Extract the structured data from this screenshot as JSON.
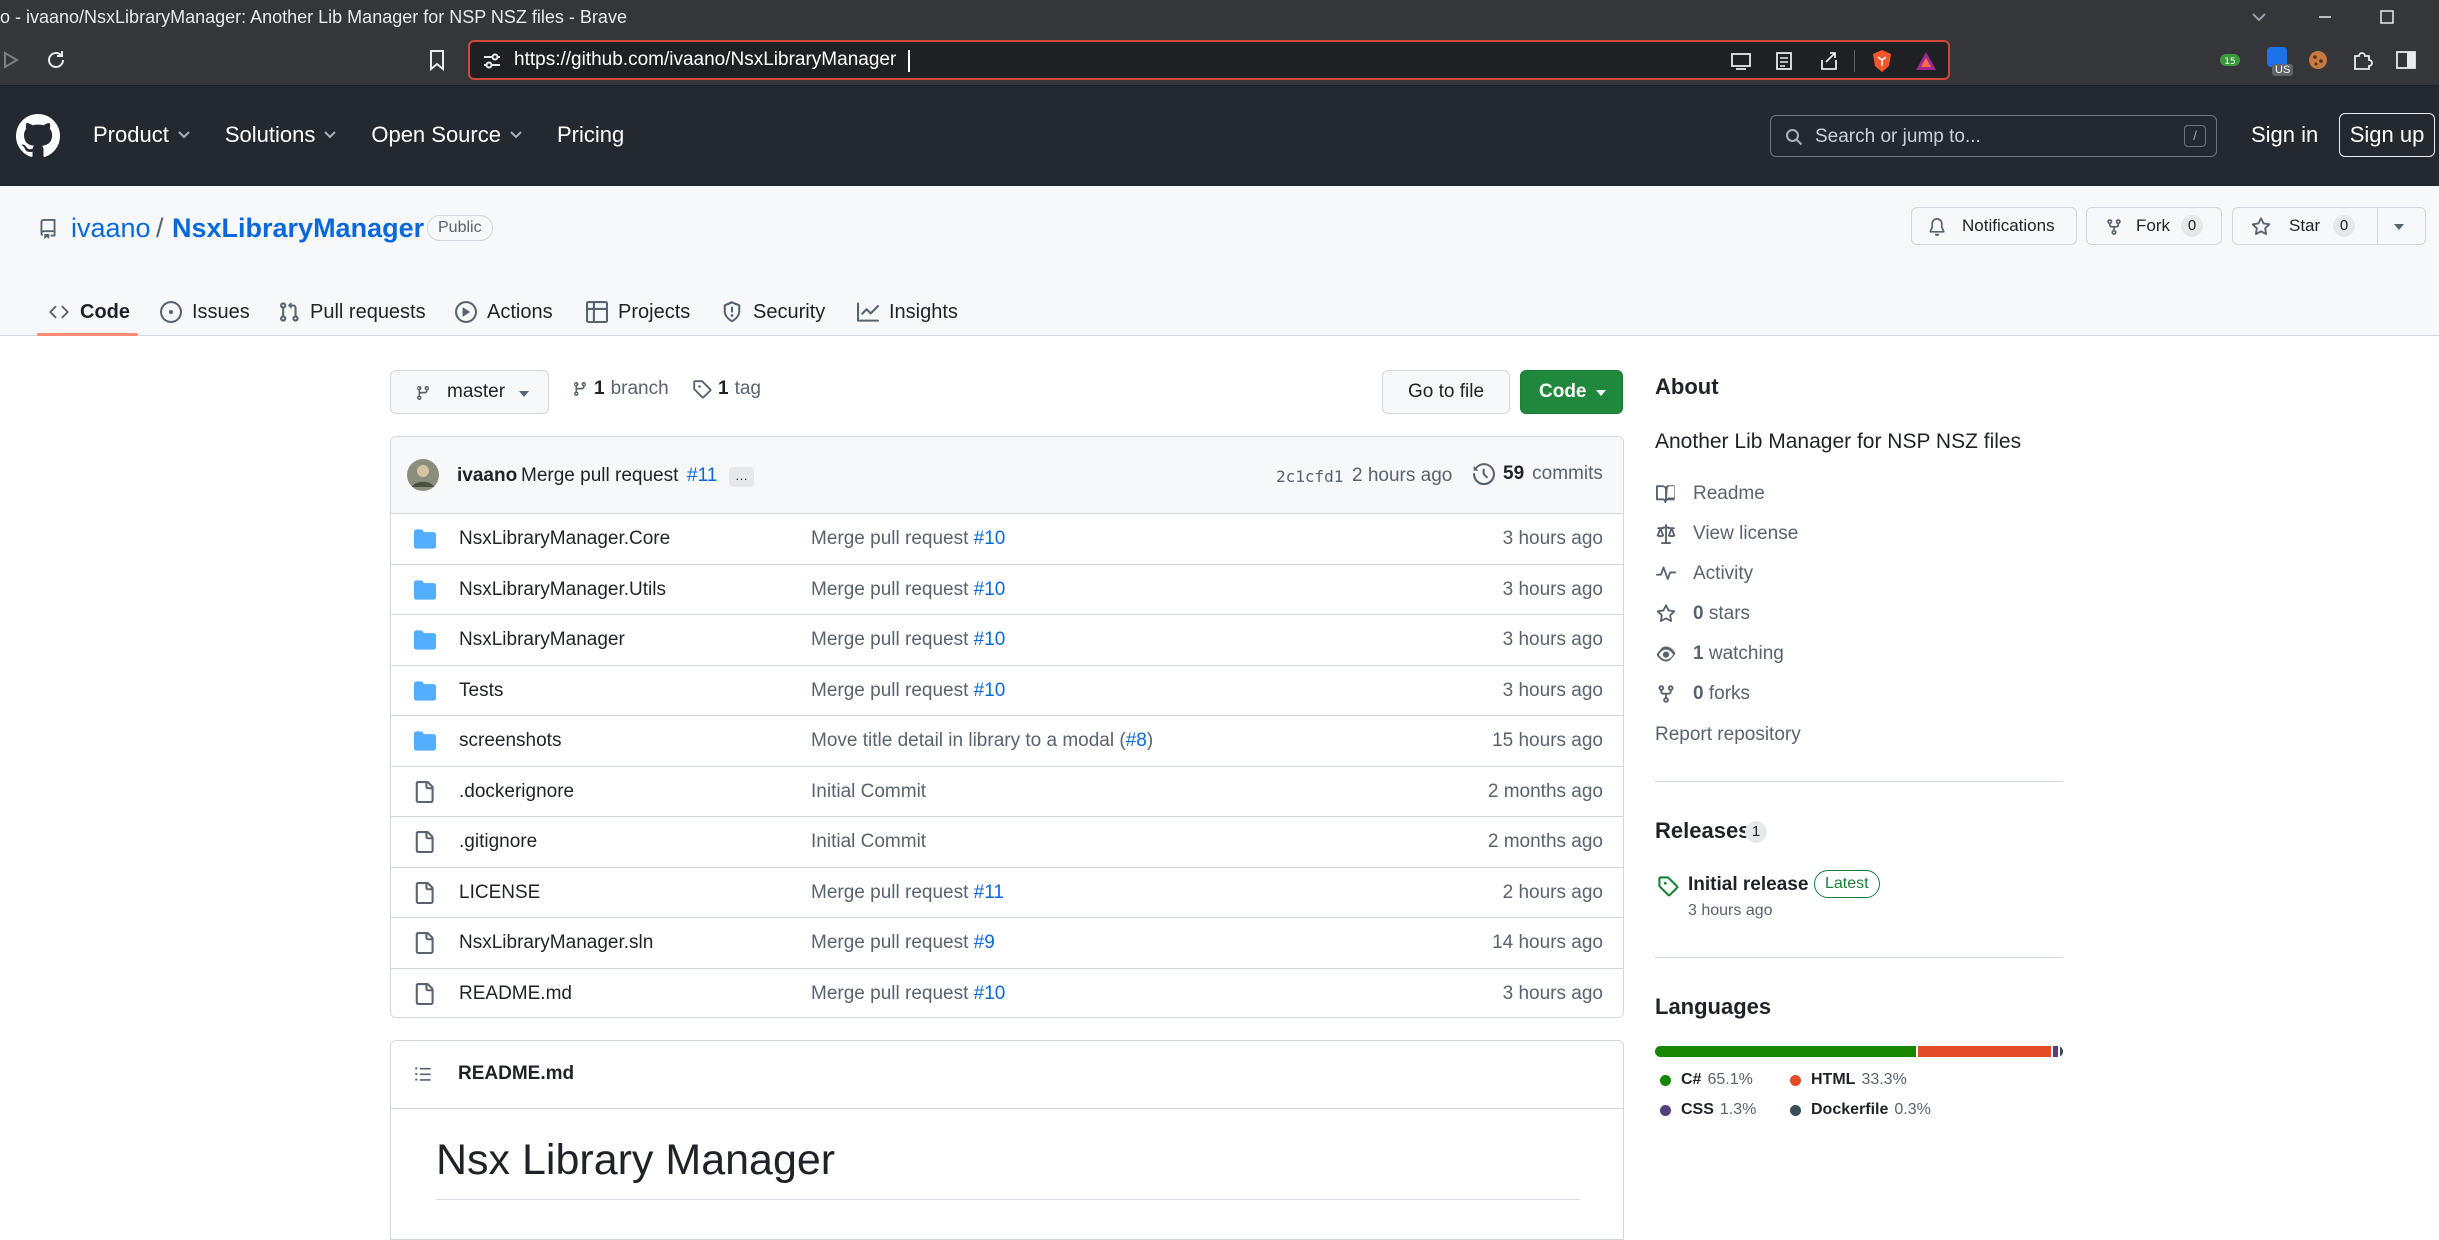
{
  "browser": {
    "window_title": "o - ivaano/NsxLibraryManager: Another Lib Manager for NSP NSZ files - Brave",
    "url": "https://github.com/ivaano/NsxLibraryManager",
    "ext_badge": "US"
  },
  "gh_header": {
    "nav": [
      "Product",
      "Solutions",
      "Open Source",
      "Pricing"
    ],
    "search_placeholder": "Search or jump to...",
    "search_kbd": "/",
    "sign_in": "Sign in",
    "sign_up": "Sign up"
  },
  "repo": {
    "owner": "ivaano",
    "separator": "/",
    "name": "NsxLibraryManager",
    "visibility": "Public",
    "notifications": "Notifications",
    "fork_label": "Fork",
    "fork_count": "0",
    "star_label": "Star",
    "star_count": "0",
    "tabs": [
      "Code",
      "Issues",
      "Pull requests",
      "Actions",
      "Projects",
      "Security",
      "Insights"
    ]
  },
  "code_bar": {
    "branch": "master",
    "branch_count": "1",
    "branch_label": "branch",
    "tag_count": "1",
    "tag_label": "tag",
    "go_to_file": "Go to file",
    "code_button": "Code"
  },
  "commit": {
    "author": "ivaano",
    "message": "Merge pull request",
    "pr": "#11",
    "ellipsis": "…",
    "sha": "2c1cfd1",
    "time": "2 hours ago",
    "count": "59",
    "count_label": "commits"
  },
  "files": [
    {
      "type": "dir",
      "name": "NsxLibraryManager.Core",
      "msg": "Merge pull request ",
      "pr": "#10",
      "after": "",
      "time": "3 hours ago"
    },
    {
      "type": "dir",
      "name": "NsxLibraryManager.Utils",
      "msg": "Merge pull request ",
      "pr": "#10",
      "after": "",
      "time": "3 hours ago"
    },
    {
      "type": "dir",
      "name": "NsxLibraryManager",
      "msg": "Merge pull request ",
      "pr": "#10",
      "after": "",
      "time": "3 hours ago"
    },
    {
      "type": "dir",
      "name": "Tests",
      "msg": "Merge pull request ",
      "pr": "#10",
      "after": "",
      "time": "3 hours ago"
    },
    {
      "type": "dir",
      "name": "screenshots",
      "msg": "Move title detail in library to a modal (",
      "pr": "#8",
      "after": ")",
      "time": "15 hours ago"
    },
    {
      "type": "file",
      "name": ".dockerignore",
      "msg": "Initial Commit",
      "pr": "",
      "after": "",
      "time": "2 months ago"
    },
    {
      "type": "file",
      "name": ".gitignore",
      "msg": "Initial Commit",
      "pr": "",
      "after": "",
      "time": "2 months ago"
    },
    {
      "type": "file",
      "name": "LICENSE",
      "msg": "Merge pull request ",
      "pr": "#11",
      "after": "",
      "time": "2 hours ago"
    },
    {
      "type": "file",
      "name": "NsxLibraryManager.sln",
      "msg": "Merge pull request ",
      "pr": "#9",
      "after": "",
      "time": "14 hours ago"
    },
    {
      "type": "file",
      "name": "README.md",
      "msg": "Merge pull request ",
      "pr": "#10",
      "after": "",
      "time": "3 hours ago"
    }
  ],
  "readme": {
    "filename": "README.md",
    "heading": "Nsx Library Manager"
  },
  "about": {
    "title": "About",
    "description": "Another Lib Manager for NSP NSZ files",
    "readme": "Readme",
    "license": "View license",
    "activity": "Activity",
    "stars_count": "0",
    "stars_label": "stars",
    "watching_count": "1",
    "watching_label": "watching",
    "forks_count": "0",
    "forks_label": "forks",
    "report": "Report repository"
  },
  "releases": {
    "title": "Releases",
    "count": "1",
    "name": "Initial release",
    "badge": "Latest",
    "time": "3 hours ago"
  },
  "languages": {
    "title": "Languages",
    "items": [
      {
        "name": "C#",
        "percent": "65.1%",
        "value": 65.1,
        "color": "#178600"
      },
      {
        "name": "HTML",
        "percent": "33.3%",
        "value": 33.3,
        "color": "#e34c26"
      },
      {
        "name": "CSS",
        "percent": "1.3%",
        "value": 1.3,
        "color": "#563d7c"
      },
      {
        "name": "Dockerfile",
        "percent": "0.3%",
        "value": 0.3,
        "color": "#384d54"
      }
    ]
  },
  "colors": {
    "header_bg": "#24292f",
    "accent_blue": "#0969da",
    "green_button": "#1f883d",
    "selected_tab": "#fd8c73"
  }
}
